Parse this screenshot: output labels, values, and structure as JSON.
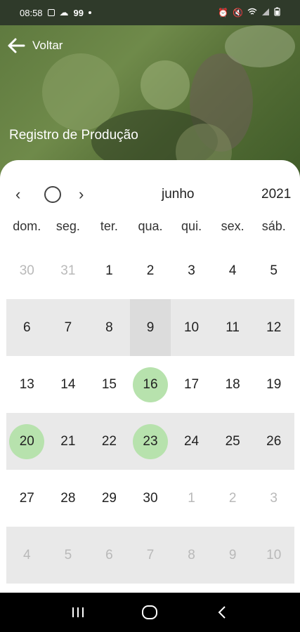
{
  "status": {
    "time": "08:58",
    "notif_count": "99",
    "icons_left": [
      "image-icon",
      "cloud-icon",
      "dot-icon"
    ],
    "icons_right": [
      "alarm-icon",
      "mute-icon",
      "wifi-icon",
      "signal-icon",
      "battery-icon"
    ]
  },
  "header": {
    "back_label": "Voltar",
    "title": "Registro de Produção"
  },
  "calendar": {
    "month": "junho",
    "year": "2021",
    "weekdays": [
      "dom.",
      "seg.",
      "ter.",
      "qua.",
      "qui.",
      "sex.",
      "sáb."
    ],
    "weeks": [
      [
        {
          "d": "30",
          "m": true
        },
        {
          "d": "31",
          "m": true
        },
        {
          "d": "1"
        },
        {
          "d": "2"
        },
        {
          "d": "3"
        },
        {
          "d": "4"
        },
        {
          "d": "5"
        }
      ],
      [
        {
          "d": "6"
        },
        {
          "d": "7"
        },
        {
          "d": "8"
        },
        {
          "d": "9",
          "today": true
        },
        {
          "d": "10"
        },
        {
          "d": "11"
        },
        {
          "d": "12"
        }
      ],
      [
        {
          "d": "13"
        },
        {
          "d": "14"
        },
        {
          "d": "15"
        },
        {
          "d": "16",
          "marked": true
        },
        {
          "d": "17"
        },
        {
          "d": "18"
        },
        {
          "d": "19"
        }
      ],
      [
        {
          "d": "20",
          "marked": true
        },
        {
          "d": "21"
        },
        {
          "d": "22"
        },
        {
          "d": "23",
          "marked": true
        },
        {
          "d": "24"
        },
        {
          "d": "25"
        },
        {
          "d": "26"
        }
      ],
      [
        {
          "d": "27"
        },
        {
          "d": "28"
        },
        {
          "d": "29"
        },
        {
          "d": "30"
        },
        {
          "d": "1",
          "m": true
        },
        {
          "d": "2",
          "m": true
        },
        {
          "d": "3",
          "m": true
        }
      ],
      [
        {
          "d": "4",
          "m": true
        },
        {
          "d": "5",
          "m": true
        },
        {
          "d": "6",
          "m": true
        },
        {
          "d": "7",
          "m": true
        },
        {
          "d": "8",
          "m": true
        },
        {
          "d": "9",
          "m": true
        },
        {
          "d": "10",
          "m": true
        }
      ]
    ],
    "marker_color": "#b7e2ad",
    "shade_color": "#e9e9e9"
  },
  "system_nav": [
    "recents-button",
    "home-button",
    "back-button"
  ]
}
